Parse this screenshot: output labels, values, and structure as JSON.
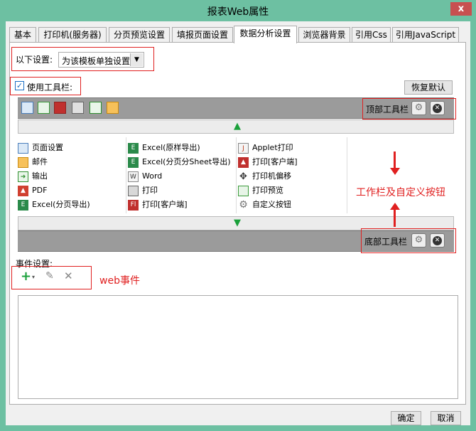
{
  "window": {
    "title": "报表Web属性",
    "close_glyph": "x"
  },
  "tabs": [
    {
      "label": "基本"
    },
    {
      "label": "打印机(服务器)"
    },
    {
      "label": "分页预览设置"
    },
    {
      "label": "填报页面设置"
    },
    {
      "label": "数据分析设置"
    },
    {
      "label": "浏览器背景"
    },
    {
      "label": "引用Css"
    },
    {
      "label": "引用JavaScript"
    }
  ],
  "settings": {
    "label": "以下设置:",
    "selected": "为该模板单独设置"
  },
  "toolbar_toggle": {
    "label": "使用工具栏:",
    "checked": true
  },
  "restore_button": "恢复默认",
  "top_toolbar": {
    "label": "顶部工具栏",
    "icons": [
      "page-setup",
      "print-preview",
      "pdf-red",
      "print",
      "export",
      "mail"
    ]
  },
  "bottom_toolbar": {
    "label": "底部工具栏"
  },
  "button_list": [
    [
      {
        "label": "页面设置",
        "icon": "page-setup"
      },
      {
        "label": "Excel(原样导出)",
        "icon": "excel"
      },
      {
        "label": "Applet打印",
        "icon": "applet"
      }
    ],
    [
      {
        "label": "邮件",
        "icon": "mail"
      },
      {
        "label": "Excel(分页分Sheet导出)",
        "icon": "excel"
      },
      {
        "label": "打印[客户端]",
        "icon": "pdf"
      }
    ],
    [
      {
        "label": "输出",
        "icon": "export"
      },
      {
        "label": "Word",
        "icon": "word"
      },
      {
        "label": "打印机偏移",
        "icon": "move"
      }
    ],
    [
      {
        "label": "PDF",
        "icon": "pdf"
      },
      {
        "label": "打印",
        "icon": "print"
      },
      {
        "label": "打印预览",
        "icon": "preview"
      }
    ],
    [
      {
        "label": "Excel(分页导出)",
        "icon": "excel"
      },
      {
        "label": "打印[客户端]",
        "icon": "flash"
      },
      {
        "label": "自定义按钮",
        "icon": "gear"
      }
    ]
  ],
  "annotations": {
    "toolbar_note": "工作栏及自定义按钮",
    "event_note": "web事件"
  },
  "events": {
    "label": "事件设置:"
  },
  "footer": {
    "ok": "确定",
    "cancel": "取消"
  },
  "colors": {
    "frame": "#6dc0a2",
    "accent_red": "#e02020",
    "close": "#c75050"
  }
}
